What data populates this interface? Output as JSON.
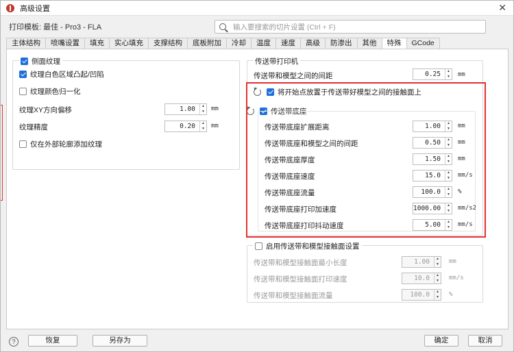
{
  "window": {
    "title": "高级设置",
    "close_label": "✕"
  },
  "topbar": {
    "template_label": "打印模板: 最佳 - Pro3 - FLA",
    "search_placeholder": "输入要搜索的切片设置 (Ctrl + F)"
  },
  "tabs": [
    "主体结构",
    "喷嘴设置",
    "填充",
    "实心填充",
    "支撑结构",
    "底板附加",
    "冷却",
    "温度",
    "速度",
    "高级",
    "防渗出",
    "其他",
    "特殊",
    "GCode"
  ],
  "active_tab": "特殊",
  "left": {
    "group_title": "侧面纹理",
    "group_checked": true,
    "options": [
      {
        "label": "纹理白色区域凸起/凹陷",
        "checked": true
      },
      {
        "label": "纹理颜色归一化",
        "checked": false
      }
    ],
    "fields": [
      {
        "label": "纹理XY方向偏移",
        "value": "1.00",
        "unit": "mm"
      },
      {
        "label": "纹理精度",
        "value": "0.20",
        "unit": "mm"
      }
    ],
    "outer_only": {
      "label": "仅在外部轮廓添加纹理",
      "checked": false
    }
  },
  "right": {
    "belt_group_title": "传送带打印机",
    "belt_gap": {
      "label": "传送带和模型之间的间距",
      "value": "0.25",
      "unit": "mm"
    },
    "place_start": {
      "label": "将开始点放置于传送带好模型之间的接触面上",
      "checked": true
    },
    "base": {
      "title": "传送带底座",
      "checked": true,
      "fields": [
        {
          "label": "传送带底座扩展距离",
          "value": "1.00",
          "unit": "mm"
        },
        {
          "label": "传送带底座和模型之间的间距",
          "value": "0.50",
          "unit": "mm"
        },
        {
          "label": "传送带底座厚度",
          "value": "1.50",
          "unit": "mm"
        },
        {
          "label": "传送带底座速度",
          "value": "15.0",
          "unit": "mm/s"
        },
        {
          "label": "传送带底座流量",
          "value": "100.0",
          "unit": "%"
        },
        {
          "label": "传送带底座打印加速度",
          "value": "1000.00",
          "unit": "mm/s2"
        },
        {
          "label": "传送带底座打印抖动速度",
          "value": "5.00",
          "unit": "mm/s"
        }
      ]
    },
    "contact": {
      "title": "启用传送带和模型接触面设置",
      "checked": false,
      "fields": [
        {
          "label": "传送带和模型接触面最小长度",
          "value": "1.00",
          "unit": "mm"
        },
        {
          "label": "传送带和模型接触面打印速度",
          "value": "10.0",
          "unit": "mm/s"
        },
        {
          "label": "传送带和模型接触面流量",
          "value": "100.0",
          "unit": "%"
        }
      ]
    }
  },
  "buttons": {
    "help": "?",
    "restore": "恢复",
    "save_as": "另存为",
    "ok": "确定",
    "cancel": "取消"
  },
  "colors": {
    "accent": "#1e6fd9",
    "highlight": "#e23030"
  }
}
